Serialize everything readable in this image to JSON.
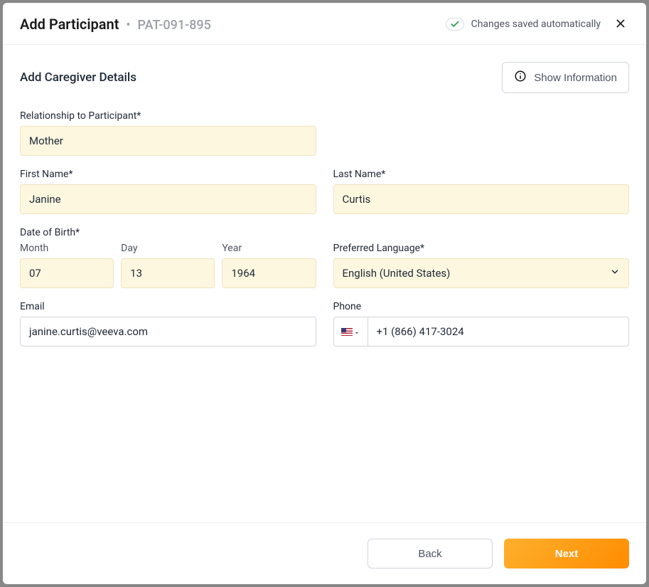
{
  "header": {
    "title": "Add Participant",
    "participant_id": "PAT-091-895",
    "saved_text": "Changes saved automatically"
  },
  "section": {
    "title": "Add Caregiver Details",
    "show_info_label": "Show Information"
  },
  "fields": {
    "relationship": {
      "label": "Relationship to Participant*",
      "value": "Mother"
    },
    "first_name": {
      "label": "First Name*",
      "value": "Janine"
    },
    "last_name": {
      "label": "Last Name*",
      "value": "Curtis"
    },
    "dob": {
      "label": "Date of Birth*",
      "month_label": "Month",
      "month_value": "07",
      "day_label": "Day",
      "day_value": "13",
      "year_label": "Year",
      "year_value": "1964"
    },
    "language": {
      "label": "Preferred Language*",
      "value": "English (United States)"
    },
    "email": {
      "label": "Email",
      "value": "janine.curtis@veeva.com"
    },
    "phone": {
      "label": "Phone",
      "value": "+1 (866) 417-3024"
    }
  },
  "footer": {
    "back_label": "Back",
    "next_label": "Next"
  }
}
